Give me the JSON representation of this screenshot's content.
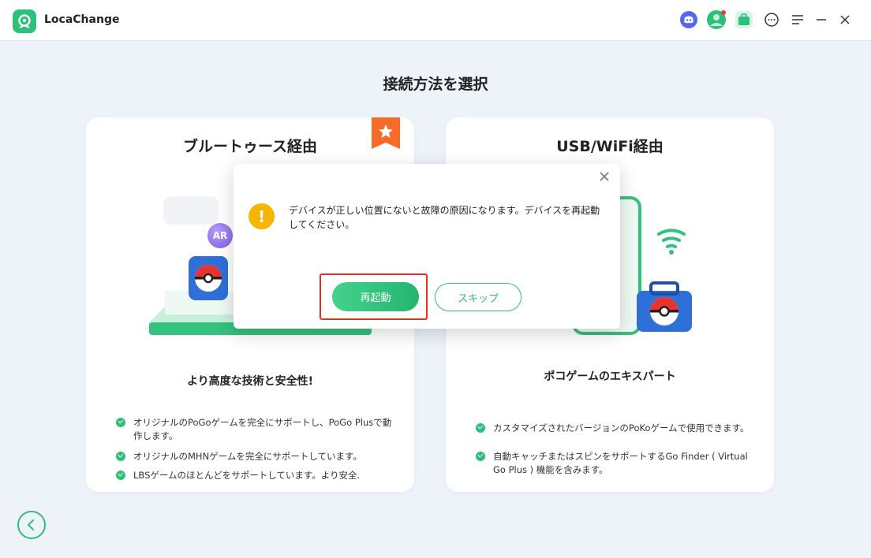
{
  "app": {
    "name": "LocaChange"
  },
  "titlebar": {
    "icons": [
      "discord-icon",
      "user-avatar-icon",
      "toolbox-icon",
      "feedback-icon",
      "menu-icon",
      "minimize-icon",
      "close-icon"
    ]
  },
  "page": {
    "title": "接続方法を選択"
  },
  "cards": {
    "bluetooth": {
      "title": "ブルートゥース経由",
      "subtitle": "より高度な技術と安全性!",
      "badge_icon": "star-badge-icon",
      "ar_label": "AR",
      "features": [
        "オリジナルのPoGoゲームを完全にサポートし、PoGo Plusで動作します。",
        "オリジナルのMHNゲームを完全にサポートしています。",
        "LBSゲームのほとんどをサポートしています。より安全."
      ]
    },
    "usb": {
      "title": "USB/WiFi経由",
      "subtitle": "ポコゲームのエキスパート",
      "features": [
        "カスタマイズされたバージョンのPoKoゲームで使用できます。",
        "自動キャッチまたはスピンをサポートするGo Finder ( Virtual Go Plus ) 機能を含みます。"
      ]
    }
  },
  "dialog": {
    "message": "デバイスが正しい位置にないと故障の原因になります。デバイスを再起動してください。",
    "primary_label": "再起動",
    "secondary_label": "スキップ"
  },
  "colors": {
    "accent": "#2cc07a",
    "warning": "#f7b500",
    "highlight": "#e0341d"
  }
}
